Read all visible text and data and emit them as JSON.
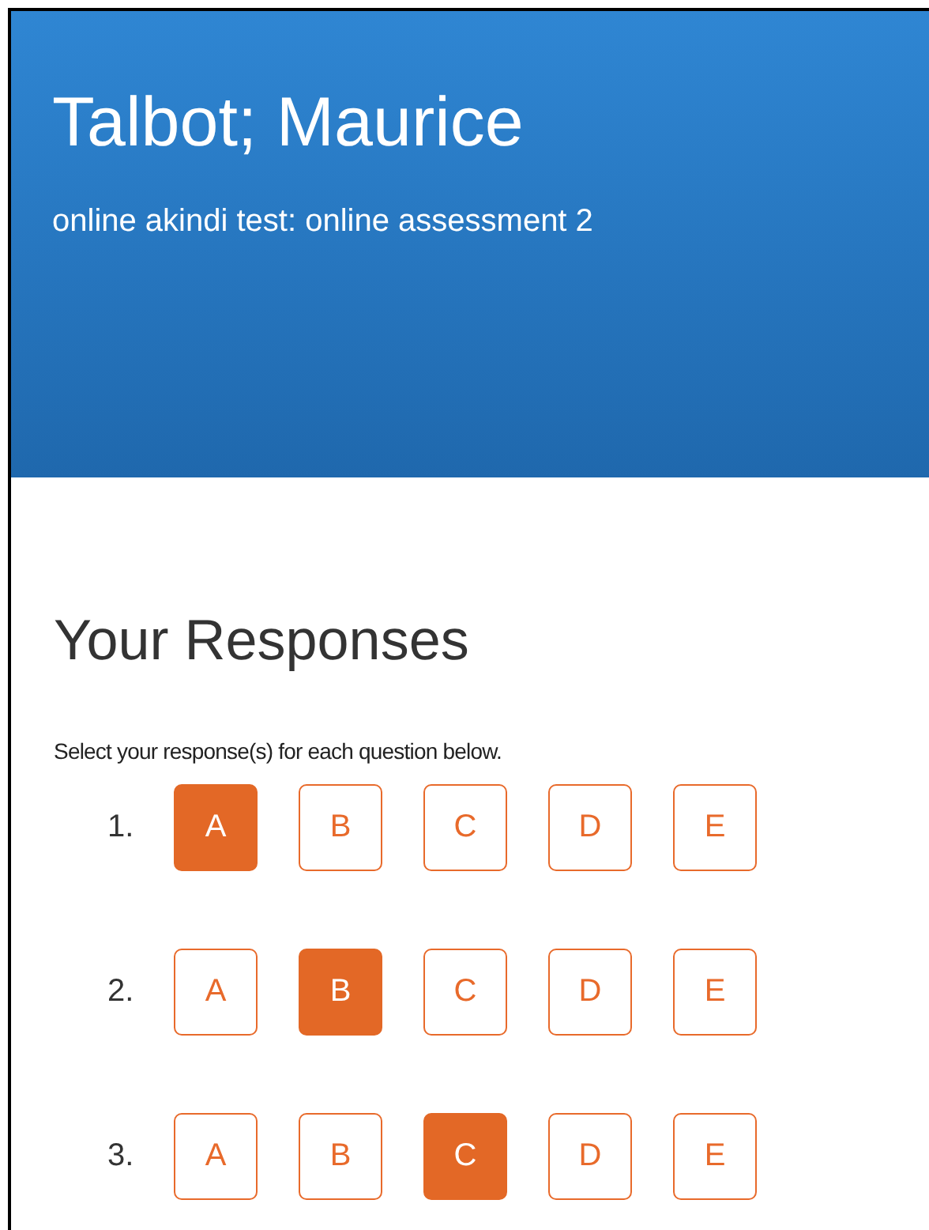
{
  "header": {
    "title": "Talbot; Maurice",
    "subtitle": "online akindi test: online assessment 2"
  },
  "responses": {
    "heading": "Your Responses",
    "instruction": "Select your response(s) for each question below.",
    "questions": [
      {
        "number": "1.",
        "options": [
          {
            "label": "A",
            "selected": true
          },
          {
            "label": "B",
            "selected": false
          },
          {
            "label": "C",
            "selected": false
          },
          {
            "label": "D",
            "selected": false
          },
          {
            "label": "E",
            "selected": false
          }
        ]
      },
      {
        "number": "2.",
        "options": [
          {
            "label": "A",
            "selected": false
          },
          {
            "label": "B",
            "selected": true
          },
          {
            "label": "C",
            "selected": false
          },
          {
            "label": "D",
            "selected": false
          },
          {
            "label": "E",
            "selected": false
          }
        ]
      },
      {
        "number": "3.",
        "options": [
          {
            "label": "A",
            "selected": false
          },
          {
            "label": "B",
            "selected": false
          },
          {
            "label": "C",
            "selected": true
          },
          {
            "label": "D",
            "selected": false
          },
          {
            "label": "E",
            "selected": false
          }
        ]
      }
    ]
  }
}
